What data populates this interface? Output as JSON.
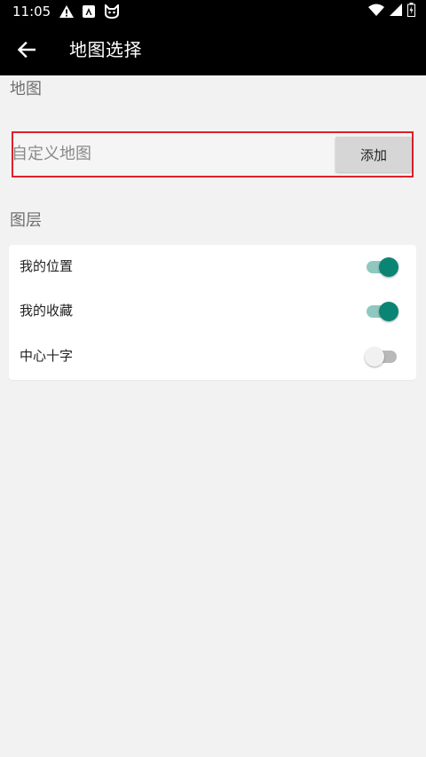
{
  "status_bar": {
    "time": "11:05",
    "notification_icons": [
      "warning-icon",
      "app-store-icon",
      "cat-face-icon"
    ],
    "system_icons": [
      "wifi-icon",
      "signal-icon",
      "battery-icon"
    ]
  },
  "app_bar": {
    "title": "地图选择",
    "back_icon": "arrow-left-icon"
  },
  "map_section": {
    "title": "地图",
    "custom_map_label": "自定义地图",
    "add_button_label": "添加"
  },
  "layers_section": {
    "title": "图层",
    "items": [
      {
        "label": "我的位置",
        "enabled": true
      },
      {
        "label": "我的收藏",
        "enabled": true
      },
      {
        "label": "中心十字",
        "enabled": false
      }
    ]
  },
  "colors": {
    "accent": "#0b8573",
    "accent_track": "#8fc8c0",
    "highlight_border": "#e0202a",
    "background": "#f2f2f2"
  }
}
